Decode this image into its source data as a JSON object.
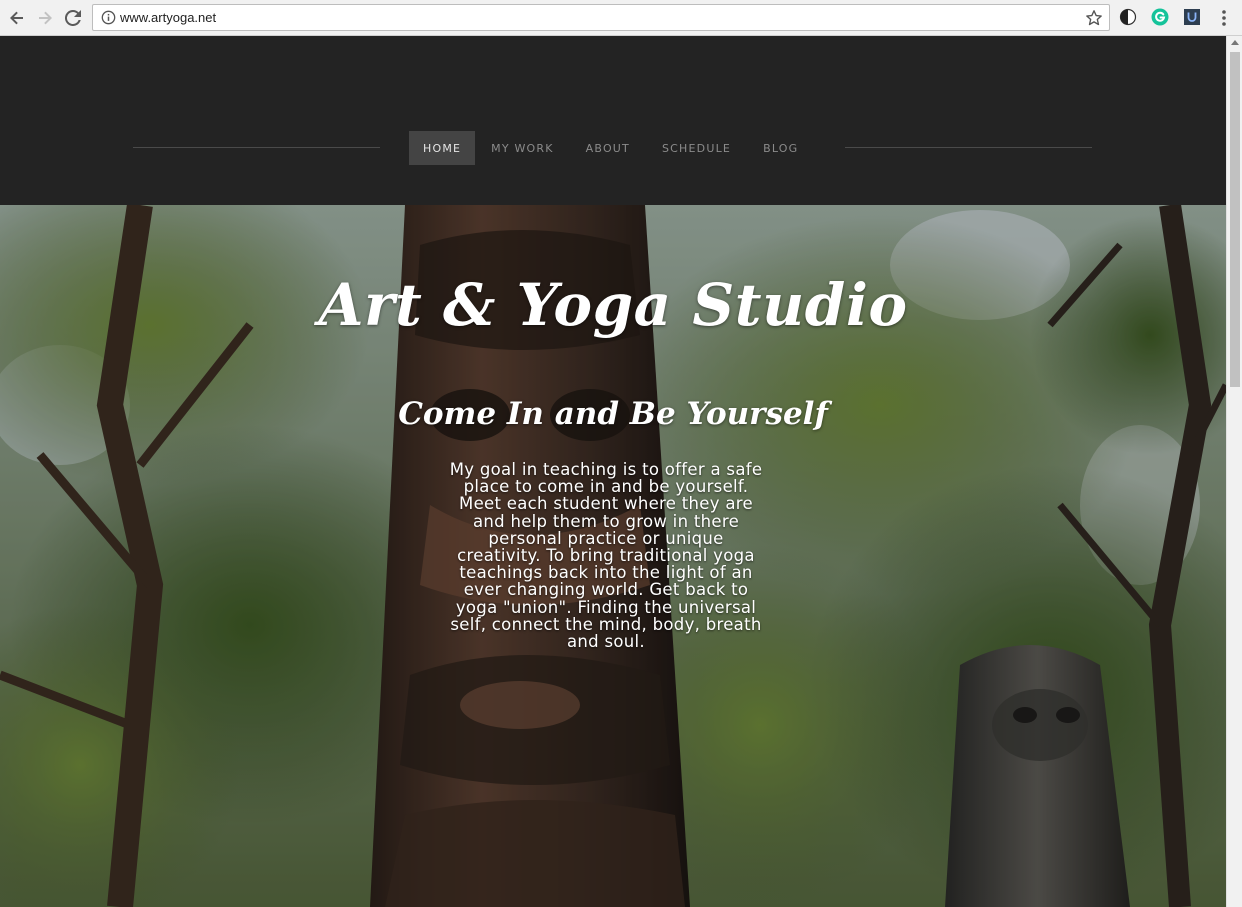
{
  "browser": {
    "url": "www.artyoga.net",
    "back_icon": "back-arrow-icon",
    "forward_icon": "forward-arrow-icon",
    "reload_icon": "reload-icon",
    "info_icon": "info-icon",
    "bookmark_icon": "star-icon",
    "extensions": [
      "contrast-extension-icon",
      "grammarly-extension-icon",
      "ublock-extension-icon"
    ],
    "menu_icon": "more-vert-icon"
  },
  "nav": {
    "items": [
      {
        "label": "HOME",
        "active": true
      },
      {
        "label": "MY WORK",
        "active": false
      },
      {
        "label": "ABOUT",
        "active": false
      },
      {
        "label": "SCHEDULE",
        "active": false
      },
      {
        "label": "BLOG",
        "active": false
      }
    ]
  },
  "hero": {
    "title": "Art & Yoga Studio",
    "subtitle": "Come In and Be Yourself",
    "body": "My goal in teaching is to offer a safe place to come in and be yourself. Meet each student where they are and help them to grow in there personal practice or unique creativity. To bring traditional yoga teachings back into the light of an ever changing world. Get back to yoga \"union\". Finding the universal self, connect the mind, body, breath and soul.",
    "background_image": "totem-poles-forest-photo"
  },
  "colors": {
    "header_bg": "#232323",
    "nav_active_bg": "#444444",
    "nav_text": "#8b8b8b",
    "nav_active_text": "#e5e5e5",
    "hero_text": "#ffffff"
  }
}
